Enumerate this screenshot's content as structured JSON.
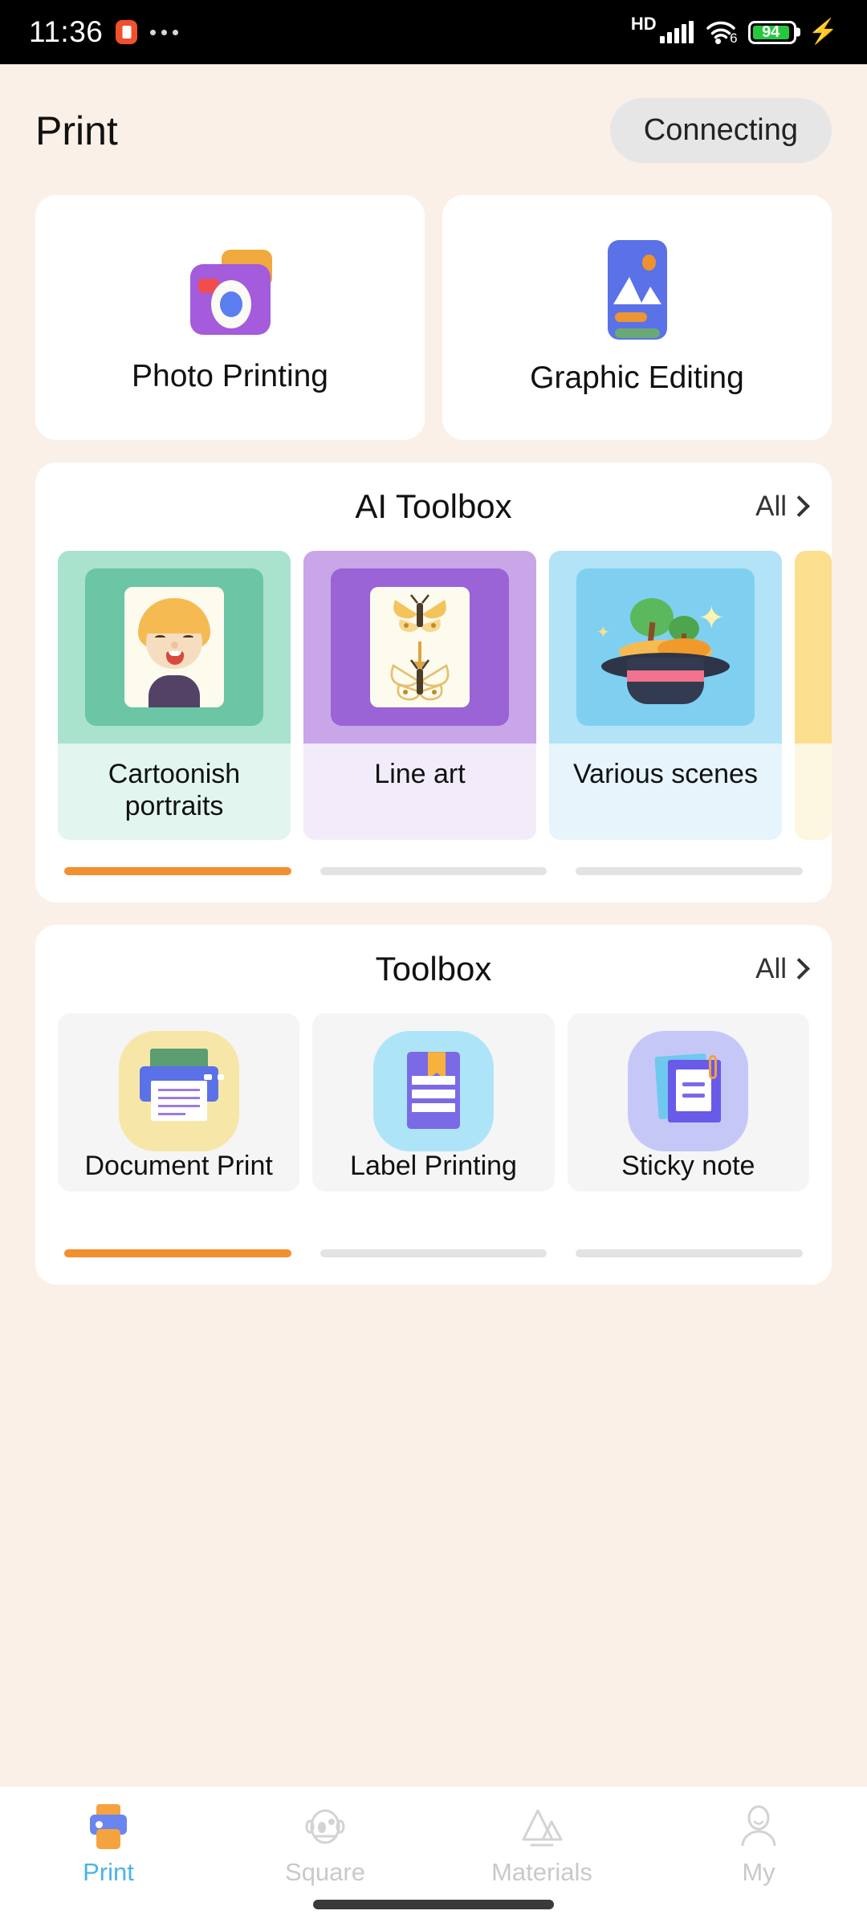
{
  "status_bar": {
    "time": "11:36",
    "app_icon": "app-badge-icon",
    "overflow": "more-dots-icon",
    "network_type": "HD",
    "signal": "signal-bars-icon",
    "wifi": "wifi-icon",
    "wifi_generation": "6",
    "battery_percent": "94",
    "battery_color": "#27c840",
    "charging": "charging-bolt-icon"
  },
  "header": {
    "title": "Print",
    "connection_status": "Connecting"
  },
  "quick_actions": [
    {
      "label": "Photo Printing",
      "icon": "camera-icon"
    },
    {
      "label": "Graphic Editing",
      "icon": "image-edit-icon"
    }
  ],
  "ai_toolbox": {
    "title": "AI Toolbox",
    "all_label": "All",
    "all_chevron": "chevron-right-icon",
    "items": [
      {
        "label": "Cartoonish portraits",
        "icon": "cartoon-portrait-icon",
        "thumb_bg": "#a9e3cd",
        "inner_bg": "#6cc5a4",
        "name_bg": "#e2f6ef"
      },
      {
        "label": "Line art",
        "icon": "line-art-butterfly-icon",
        "thumb_bg": "#c9a6e8",
        "inner_bg": "#9a63d6",
        "name_bg": "#f2ecfa"
      },
      {
        "label": "Various scenes",
        "icon": "magic-hat-scene-icon",
        "thumb_bg": "#b3e3f7",
        "inner_bg": "#7fd0f0",
        "name_bg": "#e6f5fc"
      },
      {
        "label": "",
        "icon": "next-card-peek",
        "thumb_bg": "#fbdf8f",
        "inner_bg": "#fbdf8f",
        "name_bg": "#fdf6e0"
      }
    ],
    "pagination": {
      "total": 3,
      "active_index": 0,
      "active_color": "#f28f2e",
      "inactive_color": "#e3e3e3"
    }
  },
  "toolbox": {
    "title": "Toolbox",
    "all_label": "All",
    "all_chevron": "chevron-right-icon",
    "items": [
      {
        "label": "Document Print",
        "icon": "printer-icon",
        "bg": "#f6e7a8"
      },
      {
        "label": "Label Printing",
        "icon": "label-document-icon",
        "bg": "#aee4f7"
      },
      {
        "label": "Sticky note",
        "icon": "sticky-notes-icon",
        "bg": "#c5c8f7"
      }
    ],
    "pagination": {
      "total": 3,
      "active_index": 0,
      "active_color": "#f28f2e",
      "inactive_color": "#e3e3e3"
    }
  },
  "bottom_nav": {
    "active_index": 0,
    "active_color": "#4cb3e8",
    "items": [
      {
        "label": "Print",
        "icon": "printer-nav-icon"
      },
      {
        "label": "Square",
        "icon": "robot-face-icon"
      },
      {
        "label": "Materials",
        "icon": "mountain-icon"
      },
      {
        "label": "My",
        "icon": "person-icon"
      }
    ]
  }
}
